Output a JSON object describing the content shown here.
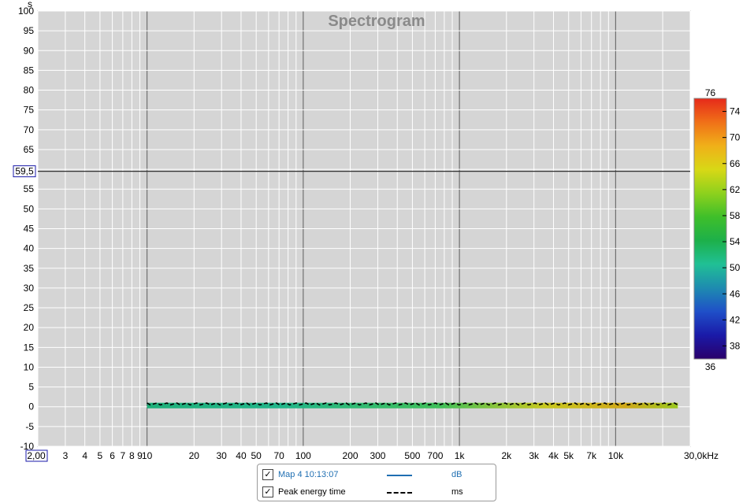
{
  "chart_data": {
    "type": "heatmap",
    "title": "Spectrogram",
    "ylabel": "s",
    "xunit": "kHz",
    "xscale": "log",
    "xlim": [
      2,
      30000
    ],
    "ylim": [
      -10,
      100
    ],
    "grid": true,
    "x_ticks": [
      {
        "v": 3,
        "label": "3"
      },
      {
        "v": 4,
        "label": "4"
      },
      {
        "v": 5,
        "label": "5"
      },
      {
        "v": 6,
        "label": "6"
      },
      {
        "v": 7,
        "label": "7"
      },
      {
        "v": 8,
        "label": "8"
      },
      {
        "v": 9,
        "label": "9"
      },
      {
        "v": 10,
        "label": "10"
      },
      {
        "v": 20,
        "label": "20"
      },
      {
        "v": 30,
        "label": "30"
      },
      {
        "v": 40,
        "label": "40"
      },
      {
        "v": 50,
        "label": "50"
      },
      {
        "v": 70,
        "label": "70"
      },
      {
        "v": 100,
        "label": "100"
      },
      {
        "v": 200,
        "label": "200"
      },
      {
        "v": 300,
        "label": "300"
      },
      {
        "v": 500,
        "label": "500"
      },
      {
        "v": 700,
        "label": "700"
      },
      {
        "v": 1000,
        "label": "1k"
      },
      {
        "v": 2000,
        "label": "2k"
      },
      {
        "v": 3000,
        "label": "3k"
      },
      {
        "v": 4000,
        "label": "4k"
      },
      {
        "v": 5000,
        "label": "5k"
      },
      {
        "v": 7000,
        "label": "7k"
      },
      {
        "v": 10000,
        "label": "10k"
      },
      {
        "v": 30000,
        "label": "30,0kHz"
      }
    ],
    "x_start_label": "2,00",
    "y_ticks": [
      100,
      95,
      90,
      85,
      80,
      75,
      70,
      65,
      55,
      50,
      45,
      40,
      35,
      30,
      25,
      20,
      15,
      10,
      5,
      0,
      -5,
      -10
    ],
    "cursor_y": 59.5,
    "cursor_label": "59,5",
    "colorbar": {
      "min": 36,
      "max": 76,
      "ticks": [
        74,
        70,
        66,
        62,
        58,
        54,
        50,
        46,
        42,
        38
      ],
      "min_label": "36",
      "max_label": "76",
      "colors": [
        "#2a006a",
        "#1a1aa8",
        "#1f4fc8",
        "#1e8bb0",
        "#20c095",
        "#1db04a",
        "#3fbf2a",
        "#8ed11d",
        "#d8d816",
        "#f0b019",
        "#f07018",
        "#e62a1a"
      ]
    },
    "band": {
      "x_start": 10,
      "x_end": 25000,
      "y_values": [
        0,
        1
      ]
    },
    "series": [
      {
        "name": "Mар 4 10:13:07",
        "unit": "dB",
        "color": "#1f6fb2",
        "style": "solid"
      },
      {
        "name": "Peak energy time",
        "unit": "ms",
        "color": "#000000",
        "style": "dashed",
        "y_approx": 0.7
      }
    ]
  },
  "legend": {
    "items": [
      {
        "label": "Mар 4 10:13:07",
        "unit": "dB",
        "color": "#1f6fb2"
      },
      {
        "label": "Peak energy time",
        "unit": "ms",
        "color": "#000000"
      }
    ]
  }
}
